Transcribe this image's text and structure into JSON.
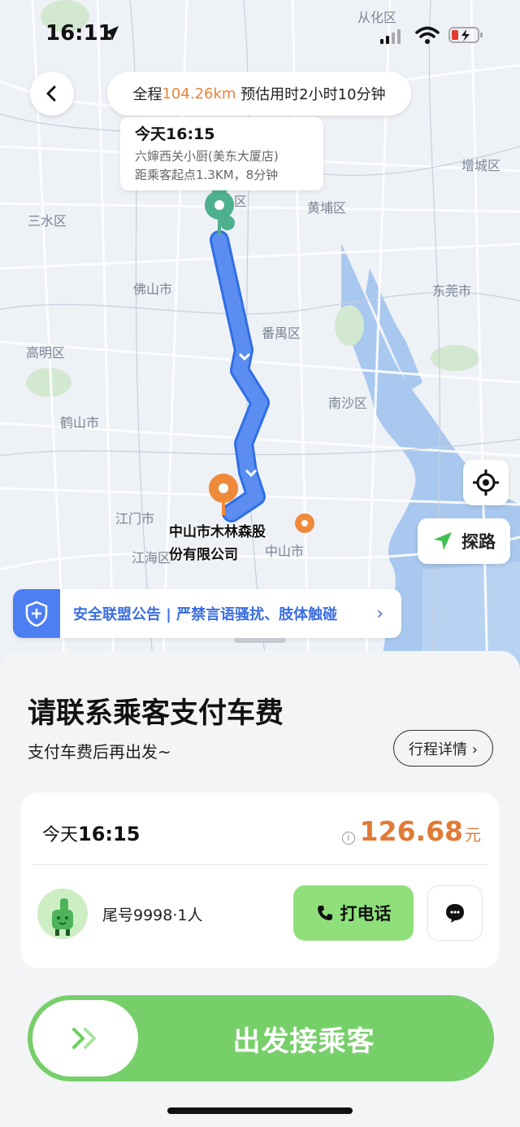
{
  "status_bar": {
    "time": "16:11"
  },
  "trip_summary": {
    "prefix": "全程",
    "distance": "104.26km",
    "suffix": " 预估用时2小时10分钟"
  },
  "pickup_card": {
    "time": "今天16:15",
    "place": "六婶西关小厨(美东大厦店)",
    "distance_text": "距乘客起点1.3KM，8分钟"
  },
  "map": {
    "labels": [
      "从化区",
      "增城区",
      "三水区",
      "黄埔区",
      "佛山市",
      "东莞市",
      "番禺区",
      "高明区",
      "南沙区",
      "鹤山市",
      "江门市",
      "中山市",
      "江海区",
      "区"
    ],
    "destination_label_line1": "中山市木林森股",
    "destination_label_line2": "份有限公司",
    "route_color": "#5b8ef0",
    "pickup_pin_color": "#4fb08f",
    "dest_pin_color": "#ef8a3a"
  },
  "controls": {
    "explore_label": "探路"
  },
  "notice": {
    "text": "安全联盟公告 | 严禁言语骚扰、肢体触碰",
    "chevron": "›"
  },
  "sheet": {
    "title": "请联系乘客支付车费",
    "subtitle": "支付车费后再出发~",
    "detail_button": "行程详情 ›"
  },
  "order": {
    "time_prefix": "今天",
    "time_value": "16:15",
    "info_icon": "i",
    "amount": "126.68",
    "unit": "元",
    "passenger": "尾号9998·1人",
    "call_label": "打电话"
  },
  "depart": {
    "label": "出发接乘客"
  },
  "colors": {
    "accent_green": "#77cf6a",
    "price_orange": "#e07a35",
    "notice_blue": "#4d7ff2"
  }
}
